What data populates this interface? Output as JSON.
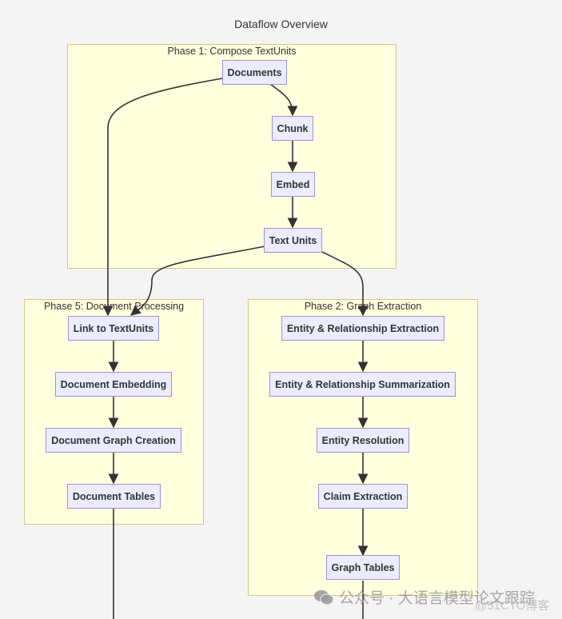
{
  "title": "Dataflow Overview",
  "clusters": {
    "phase1": {
      "label": "Phase 1: Compose TextUnits"
    },
    "phase5": {
      "label": "Phase 5: Document Processing"
    },
    "phase2": {
      "label": "Phase 2: Graph Extraction"
    }
  },
  "nodes": {
    "documents": "Documents",
    "chunk": "Chunk",
    "embed": "Embed",
    "text_units": "Text Units",
    "link_textunits": "Link to TextUnits",
    "document_embedding": "Document Embedding",
    "document_graph_creation": "Document Graph Creation",
    "document_tables": "Document Tables",
    "entity_rel_extraction": "Entity & Relationship Extraction",
    "entity_rel_summarization": "Entity & Relationship Summarization",
    "entity_resolution": "Entity Resolution",
    "claim_extraction": "Claim Extraction",
    "graph_tables": "Graph Tables"
  },
  "watermark": {
    "main": "公众号 · 大语言模型论文跟踪",
    "secondary": "@51CTO博客"
  }
}
